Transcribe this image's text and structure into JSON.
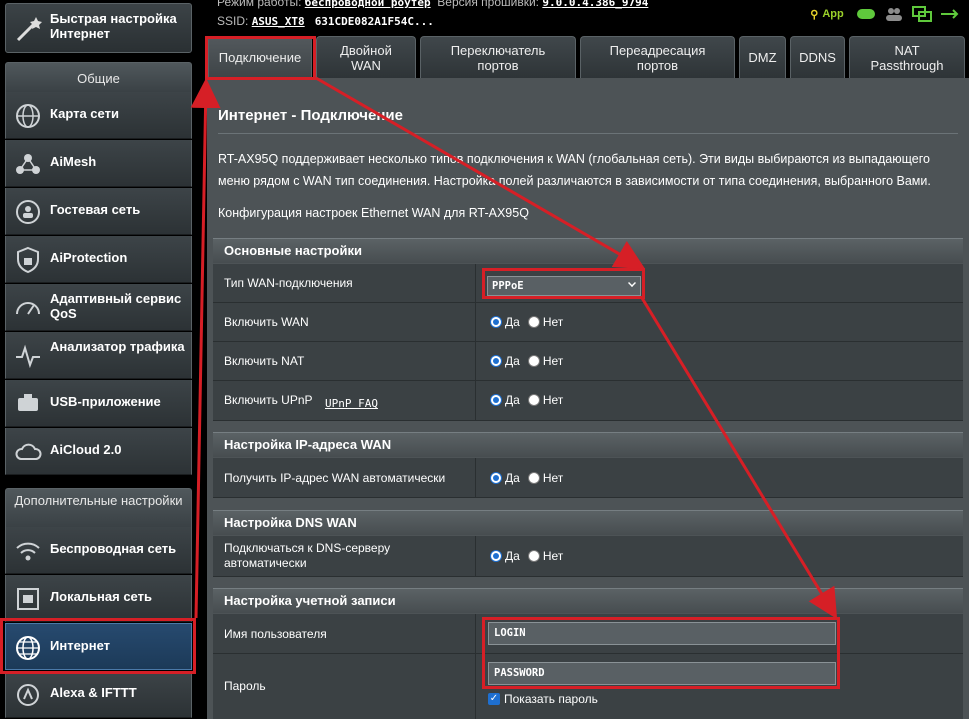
{
  "topbar": {
    "mode_label": "Режим работы:",
    "mode_value": "беспроводной роутер",
    "fw_label": "Версия прошивки:",
    "fw_value": "9.0.0.4.386_9794",
    "ssid_label": "SSID:",
    "ssid_1": "ASUS_XT8",
    "ssid_2": "631CDE082A1F54C...",
    "app_label": "App"
  },
  "sidebar": {
    "quick": "Быстрая настройка Интернет",
    "general_header": "Общие",
    "general_items": [
      {
        "label": "Карта сети"
      },
      {
        "label": "AiMesh"
      },
      {
        "label": "Гостевая сеть"
      },
      {
        "label": "AiProtection"
      },
      {
        "label": "Адаптивный сервис QoS"
      },
      {
        "label": "Анализатор трафика"
      },
      {
        "label": "USB-приложение"
      },
      {
        "label": "AiCloud 2.0"
      }
    ],
    "advanced_header": "Дополнительные настройки",
    "advanced_items": [
      {
        "label": "Беспроводная сеть"
      },
      {
        "label": "Локальная сеть"
      },
      {
        "label": "Интернет"
      },
      {
        "label": "Alexa & IFTTT"
      }
    ]
  },
  "tabs": [
    {
      "label": "Подключение",
      "active": true
    },
    {
      "label": "Двойной WAN"
    },
    {
      "label": "Переключатель портов"
    },
    {
      "label": "Переадресация портов"
    },
    {
      "label": "DMZ"
    },
    {
      "label": "DDNS"
    },
    {
      "label": "NAT Passthrough"
    }
  ],
  "main": {
    "title": "Интернет - Подключение",
    "desc": "RT-AX95Q поддерживает несколько типов подключения к WAN (глобальная сеть). Эти виды выбираются из выпадающего меню рядом с WAN тип соединения. Настройка полей различаются в зависимости от типа соединения, выбранного Вами.",
    "config": "Конфигурация настроек Ethernet WAN для RT-AX95Q",
    "groups": {
      "basic": "Основные настройки",
      "ip": "Настройка IP-адреса WAN",
      "dns": "Настройка DNS WAN",
      "account": "Настройка учетной записи"
    },
    "fields": {
      "wan_type_label": "Тип WAN-подключения",
      "wan_type_value": "PPPoE",
      "enable_wan": "Включить WAN",
      "enable_nat": "Включить NAT",
      "enable_upnp": "Включить UPnP",
      "upnp_faq": "UPnP FAQ",
      "auto_ip": "Получить IP-адрес WAN автоматически",
      "dns_auto": "Подключаться к DNS-серверу автоматически",
      "username_label": "Имя пользователя",
      "username_value": "LOGIN",
      "password_label": "Пароль",
      "password_value": "PASSWORD",
      "show_password": "Показать пароль"
    },
    "yes": "Да",
    "no": "Нет"
  },
  "colors": {
    "annotation": "#d61f26",
    "accent": "#1e6fd0"
  }
}
